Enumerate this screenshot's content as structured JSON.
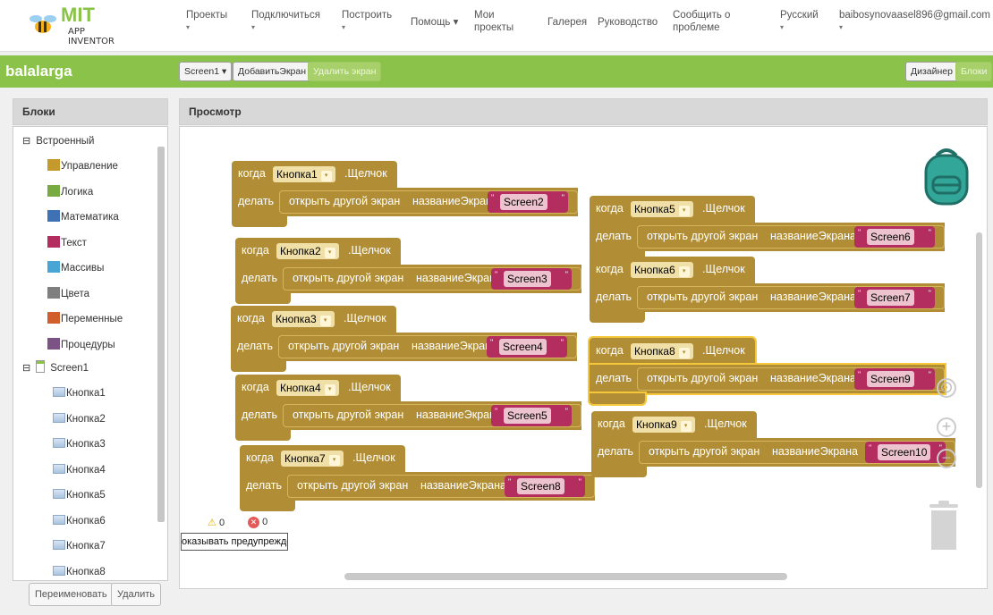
{
  "header": {
    "logo_text": "MIT",
    "logo_subtext": "APP INVENTOR",
    "menu": [
      {
        "label": "Проекты",
        "caret": "▾"
      },
      {
        "label": "Подключиться",
        "caret": "▾"
      },
      {
        "label": "Построить",
        "caret": "▾"
      },
      {
        "label": "Помощь ▾",
        "caret": ""
      },
      {
        "label": "Мои проекты",
        "caret": ""
      },
      {
        "label": "Галерея",
        "caret": ""
      },
      {
        "label": "Руководство",
        "caret": ""
      },
      {
        "label": "Сообщить о проблеме",
        "caret": ""
      },
      {
        "label": "Русский",
        "caret": "▾"
      },
      {
        "label": "baibosynovaasel896@gmail.com",
        "caret": "▾"
      }
    ]
  },
  "project_bar": {
    "name": "balalarga",
    "screen_select": "Screen1 ▾",
    "add_screen": "ДобавитьЭкран",
    "remove_screen": "Удалить экран",
    "designer": "Дизайнер",
    "blocks": "Блоки"
  },
  "blocks_panel": {
    "title": "Блоки",
    "builtin_toggle": "⊟",
    "builtin_label": "Встроенный",
    "builtin": [
      {
        "label": "Управление",
        "color": "#c49a2c"
      },
      {
        "label": "Логика",
        "color": "#77ab41"
      },
      {
        "label": "Математика",
        "color": "#3f71b5"
      },
      {
        "label": "Текст",
        "color": "#b32d5e"
      },
      {
        "label": "Массивы",
        "color": "#49a6d4"
      },
      {
        "label": "Цвета",
        "color": "#7f7f7f"
      },
      {
        "label": "Переменные",
        "color": "#d05f2d"
      },
      {
        "label": "Процедуры",
        "color": "#7c5385"
      }
    ],
    "screen_toggle": "⊟",
    "screen_label": "Screen1",
    "components": [
      "Кнопка1",
      "Кнопка2",
      "Кнопка3",
      "Кнопка4",
      "Кнопка5",
      "Кнопка6",
      "Кнопка7",
      "Кнопка8"
    ],
    "rename_button": "Переименовать",
    "delete_button": "Удалить"
  },
  "viewer": {
    "title": "Просмотр",
    "warnings_count": "0",
    "errors_count": "0",
    "show_warnings": "оказывать предупреждения"
  },
  "block_text": {
    "when": "когда",
    "event": ".Щелчок",
    "do": "делать",
    "action": "открыть другой экран",
    "param": "названиеЭкрана",
    "dropdown_arrow": "▾",
    "quote": "\""
  },
  "event_blocks": [
    {
      "button": "Кнопка1",
      "screen": "Screen2"
    },
    {
      "button": "Кнопка2",
      "screen": "Screen3"
    },
    {
      "button": "Кнопка3",
      "screen": "Screen4"
    },
    {
      "button": "Кнопка4",
      "screen": "Screen5"
    },
    {
      "button": "Кнопка7",
      "screen": "Screen8"
    },
    {
      "button": "Кнопка5",
      "screen": "Screen6"
    },
    {
      "button": "Кнопка6",
      "screen": "Screen7"
    },
    {
      "button": "Кнопка8",
      "screen": "Screen9"
    },
    {
      "button": "Кнопка9",
      "screen": "Screen10"
    }
  ]
}
